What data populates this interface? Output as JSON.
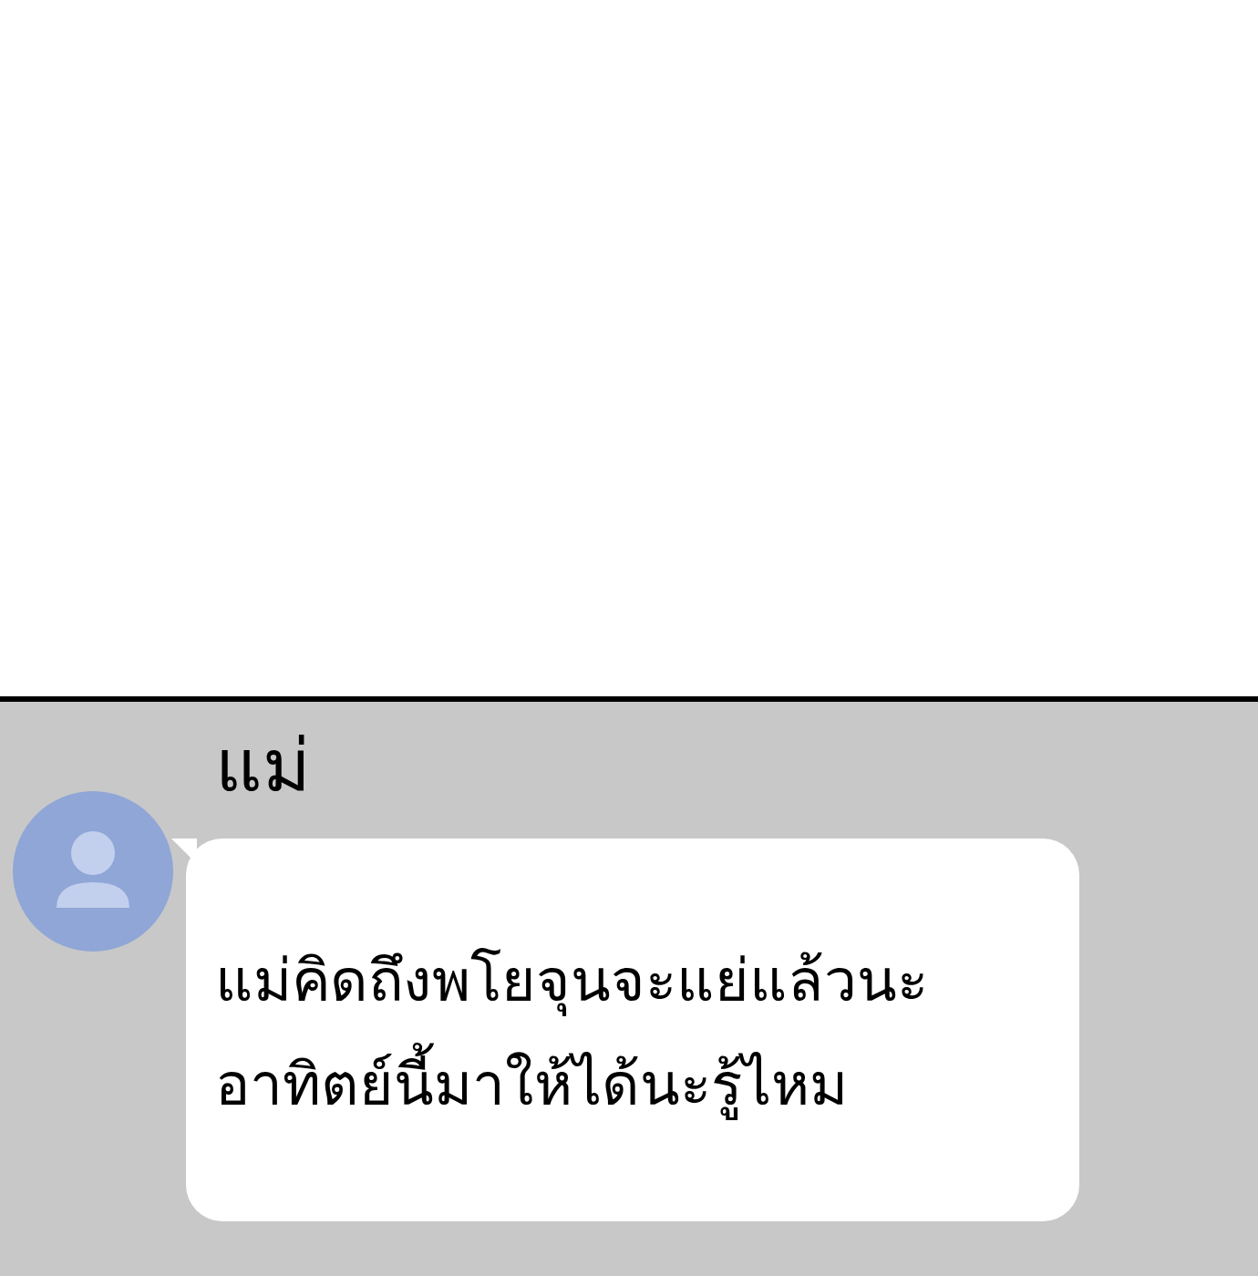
{
  "message": {
    "sender": "แม่",
    "lines": [
      "แม่คิดถึงพโยจุนจะแย่แล้วนะ",
      "อาทิตย์นี้มาให้ได้นะรู้ไหม"
    ]
  }
}
